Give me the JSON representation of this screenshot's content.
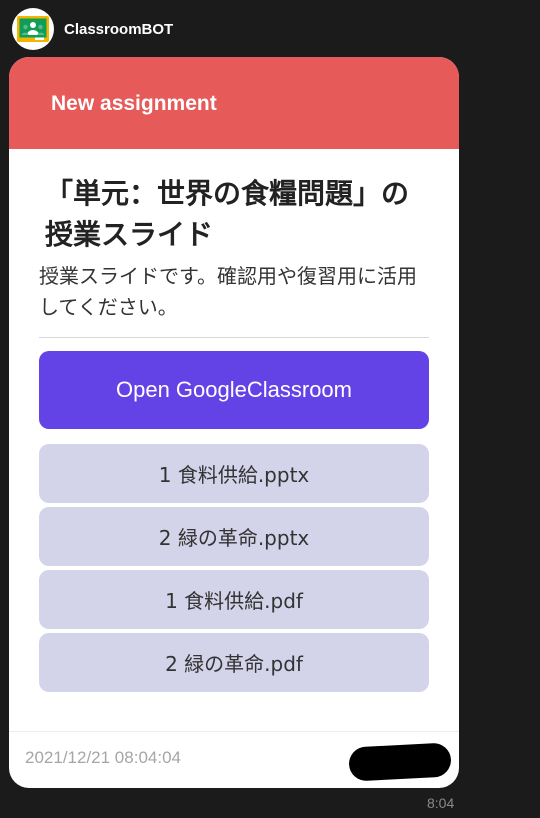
{
  "sender": {
    "name": "ClassroomBOT",
    "avatar_icon": "google-classroom-icon"
  },
  "card": {
    "header": {
      "label": "New assignment",
      "color": "#e65a5a"
    },
    "title": "「単元：世界の食糧問題」の授業スライド",
    "description": "授業スライドです。確認用や復習用に活用してください。",
    "primary_action": {
      "label": "Open GoogleClassroom",
      "color": "#6443e6"
    },
    "files": [
      {
        "label": "1 食料供給.pptx"
      },
      {
        "label": "2 緑の革命.pptx"
      },
      {
        "label": "1 食料供給.pdf"
      },
      {
        "label": "2 緑の革命.pdf"
      }
    ],
    "footer": {
      "timestamp": "2021/12/21 08:04:04"
    }
  },
  "message_time": "8:04"
}
